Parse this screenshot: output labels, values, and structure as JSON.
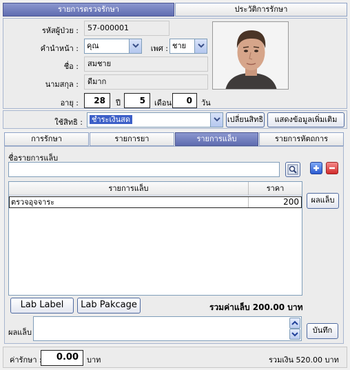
{
  "top_tabs": [
    "รายการตรวจรักษา",
    "ประวัติการรักษา"
  ],
  "patient": {
    "id_label": "รหัสผู้ป่วย :",
    "id_value": "57-000001",
    "prefix_label": "คำนำหน้า :",
    "prefix_value": "คุณ",
    "sex_label": "เพศ :",
    "sex_value": "ชาย",
    "name_label": "ชื่อ :",
    "name_value": "สมชาย",
    "surname_label": "นามสกุล :",
    "surname_value": "ดีมาก",
    "age_label": "อายุ :",
    "age_years": "28",
    "years_unit": "ปี",
    "age_months": "5",
    "months_unit": "เดือน",
    "age_days": "0",
    "days_unit": "วัน"
  },
  "rights": {
    "label": "ใช้สิทธิ :",
    "value": "ชำระเงินสด",
    "change_button": "เปลี่ยนสิทธิ",
    "more_button": "แสดงข้อมูลเพิ่มเติม"
  },
  "sub_tabs": [
    "การรักษา",
    "รายการยา",
    "รายการแล็บ",
    "รายการหัตถการ"
  ],
  "lab": {
    "name_label": "ชื่อรายการแล็บ",
    "name_value": "",
    "table_headers": [
      "รายการแล็บ",
      "ราคา"
    ],
    "rows": [
      {
        "name": "ตรวจอุจจาระ",
        "price": "200"
      }
    ],
    "result_button": "ผลแล็บ",
    "lab_label_button": "Lab Label",
    "lab_package_button": "Lab Pakcage",
    "total_text": "รวมค่าแล็บ 200.00 บาท",
    "result_label": "ผลแล็บ",
    "result_value": "",
    "save_button": "บันทึก"
  },
  "footer": {
    "fee_label": "ค่ารักษา :",
    "fee_value": "0.00",
    "fee_unit": "บาท",
    "total_text": "รวมเงิน 520.00 บาท"
  },
  "colors": {
    "active_tab": "#6b78bb",
    "selected_row": "#ffffff",
    "highlight_value": "#3c5fc8"
  }
}
